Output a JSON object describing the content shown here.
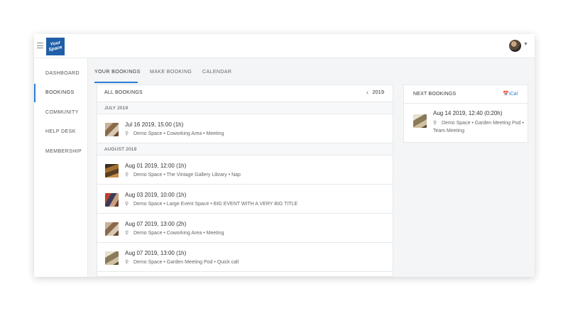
{
  "logo_text": [
    "Your",
    "Space"
  ],
  "sidebar": {
    "items": [
      {
        "label": "DASHBOARD"
      },
      {
        "label": "BOOKINGS"
      },
      {
        "label": "COMMUNITY"
      },
      {
        "label": "HELP DESK"
      },
      {
        "label": "MEMBERSHIP"
      }
    ]
  },
  "tabs": [
    {
      "label": "YOUR BOOKINGS"
    },
    {
      "label": "MAKE BOOKING"
    },
    {
      "label": "CALENDAR"
    }
  ],
  "bookings": {
    "title": "ALL BOOKINGS",
    "year": "2019",
    "months": [
      {
        "label": "JULY 2019",
        "rows": [
          {
            "when": "Jul 16 2019, 15:00 (1h)",
            "where": "Demo Space • Coworking Area • Meeting",
            "thumb": "coworking"
          }
        ]
      },
      {
        "label": "AUGUST 2019",
        "rows": [
          {
            "when": "Aug 01 2019, 12:00 (1h)",
            "where": "Demo Space • The Vintage Gallery Library • Nap",
            "thumb": "library"
          },
          {
            "when": "Aug 03 2019, 10:00 (1h)",
            "where": "Demo Space • Large Event Space • BIG EVENT WITH A VERY BIG TITLE",
            "thumb": "event"
          },
          {
            "when": "Aug 07 2019, 13:00 (2h)",
            "where": "Demo Space • Coworking Area • Meeting",
            "thumb": "coworking"
          },
          {
            "when": "Aug 07 2019, 13:00 (1h)",
            "where": "Demo Space • Garden Meeting Pod • Quick call",
            "thumb": "garden"
          }
        ]
      }
    ]
  },
  "next_bookings": {
    "title": "NEXT BOOKINGS",
    "ical_label": "iCal",
    "item": {
      "when": "Aug 14 2019, 12:40 (0:20h)",
      "where": "Demo Space • Garden Meeting Pod • Team Meeting",
      "thumb": "garden"
    }
  },
  "icons": {
    "menu": "hamburger-icon",
    "pin": "map-pin-icon",
    "calendar": "calendar-icon",
    "prev": "chevron-left-icon",
    "next": "chevron-right-icon"
  },
  "colors": {
    "accent": "#2a7fd4",
    "logo_bg": "#1f5fa8"
  }
}
